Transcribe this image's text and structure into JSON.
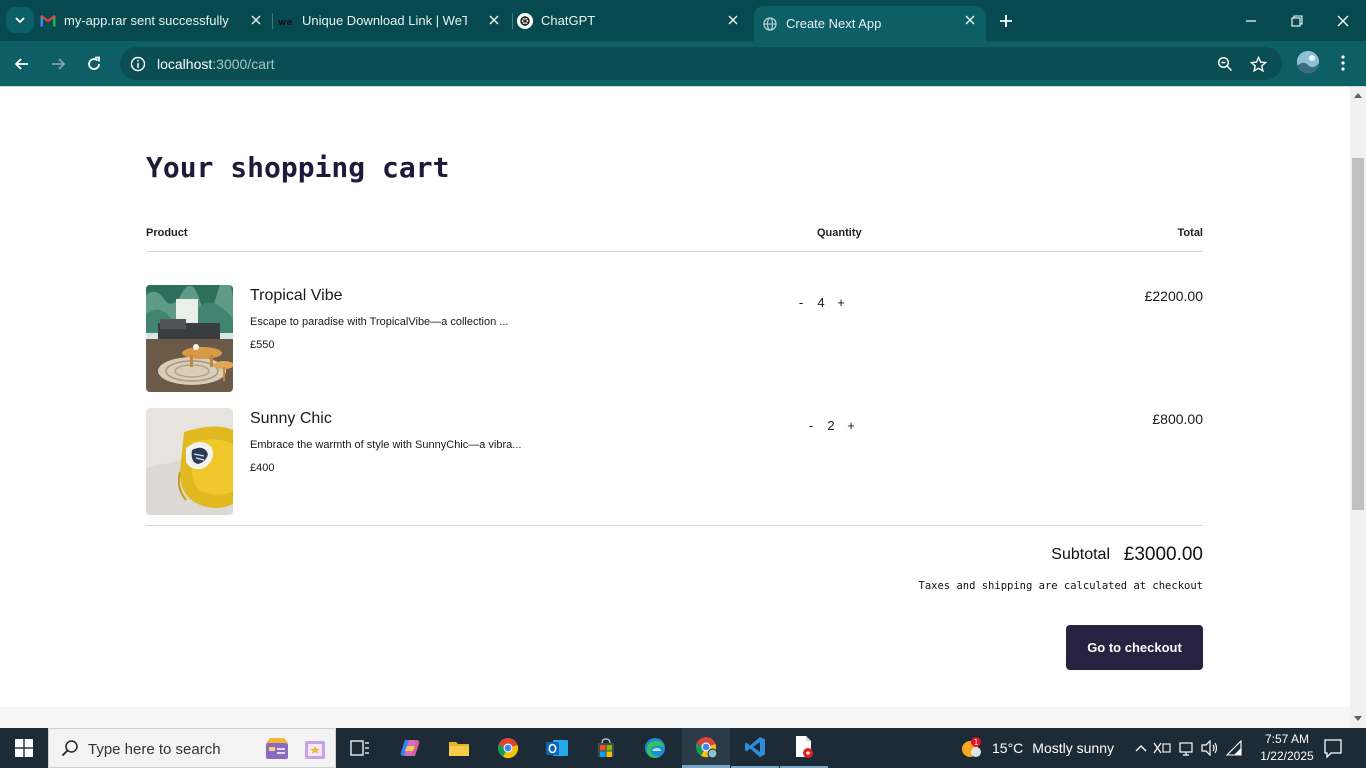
{
  "browser": {
    "tabs": [
      {
        "title": "my-app.rar sent successfully to",
        "icon": "gmail-icon"
      },
      {
        "title": "Unique Download Link | WeTrans",
        "icon": "wetransfer-icon"
      },
      {
        "title": "ChatGPT",
        "icon": "chatgpt-icon"
      },
      {
        "title": "Create Next App",
        "icon": "globe-icon"
      }
    ],
    "active_tab": 3,
    "url_host": "localhost",
    "url_path": ":3000/cart"
  },
  "cart": {
    "heading": "Your shopping cart",
    "columns": {
      "product": "Product",
      "quantity": "Quantity",
      "total": "Total"
    },
    "items": [
      {
        "name": "Tropical Vibe",
        "description": "Escape to paradise with TropicalVibe—a collection ...",
        "price": "£550",
        "quantity": "4",
        "total": "£2200.00",
        "image": "living-room-photo"
      },
      {
        "name": "Sunny Chic",
        "description": "Embrace the warmth of style with SunnyChic—a vibra...",
        "price": "£400",
        "quantity": "2",
        "total": "£800.00",
        "image": "yellow-chair-photo"
      }
    ],
    "qty_minus": "-",
    "qty_plus": "+",
    "subtotal_label": "Subtotal",
    "subtotal_value": "£3000.00",
    "tax_note": "Taxes and shipping are calculated at checkout",
    "checkout_label": "Go to checkout"
  },
  "taskbar": {
    "search_placeholder": "Type here to search",
    "weather_temp": "15°C",
    "weather_text": "Mostly sunny",
    "weather_badge": "1",
    "time": "7:57 AM",
    "date": "1/22/2025"
  },
  "colors": {
    "tabbar": "#064a50",
    "toolbar": "#0e5e66",
    "checkout_button": "#27223f",
    "heading": "#1e1b3a",
    "taskbar": "#1c2b35"
  }
}
